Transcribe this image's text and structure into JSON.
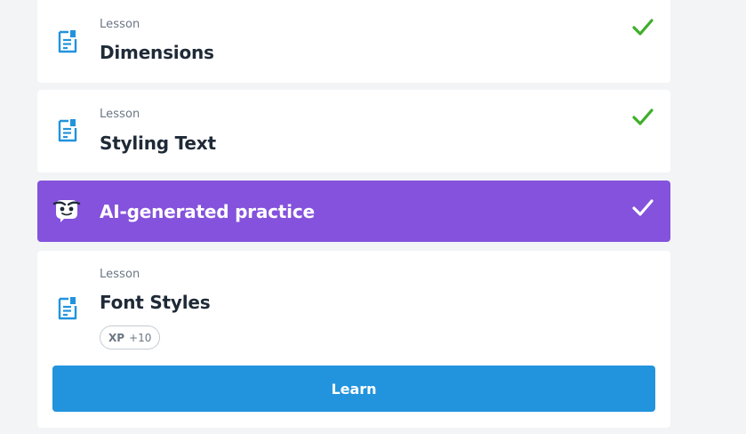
{
  "lessons": [
    {
      "kind": "Lesson",
      "title": "Dimensions",
      "completed": true,
      "icon": "document-icon",
      "check_icon": "check-icon"
    },
    {
      "kind": "Lesson",
      "title": "Styling Text",
      "completed": true,
      "icon": "document-icon",
      "check_icon": "check-icon"
    }
  ],
  "ai_practice": {
    "title": "AI-generated practice",
    "completed": true,
    "icon": "ai-face-icon",
    "background": "#8452dc"
  },
  "current_lesson": {
    "kind": "Lesson",
    "title": "Font Styles",
    "xp_label": "XP",
    "xp_value": "+10",
    "button_label": "Learn",
    "button_color": "#2293dd"
  },
  "colors": {
    "check_green": "#3fae29",
    "icon_blue": "#2293dd",
    "page_bg": "#f2f4f6"
  }
}
